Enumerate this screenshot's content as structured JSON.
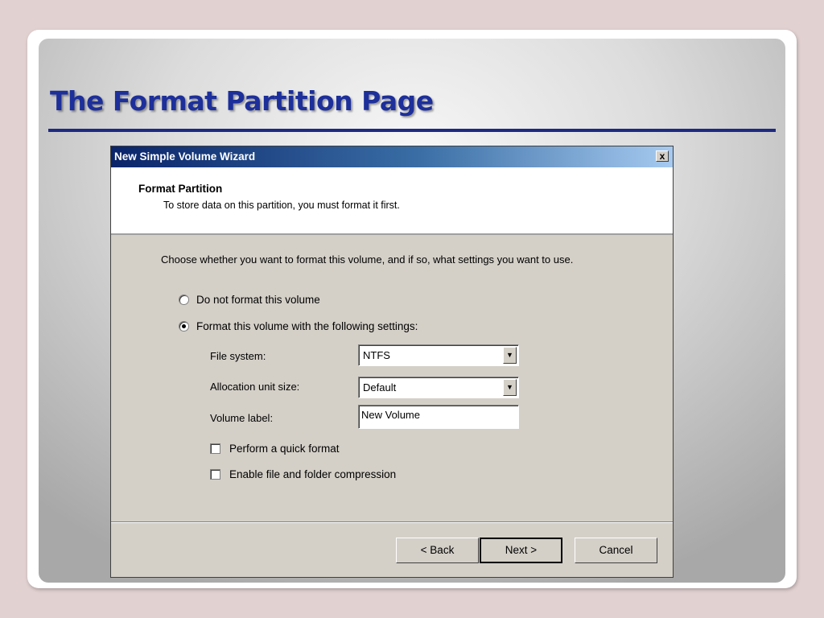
{
  "slide": {
    "title": "The Format Partition Page"
  },
  "wizard": {
    "window_title": "New Simple Volume Wizard",
    "close_label": "x",
    "header": {
      "title": "Format Partition",
      "subtitle": "To store data on this partition, you must format it first."
    },
    "instructions": "Choose whether you want to format this volume, and if so, what settings you want to use.",
    "options": {
      "no_format_label": "Do not format this volume",
      "no_format_selected": false,
      "format_label": "Format this volume with the following settings:",
      "format_selected": true
    },
    "fields": {
      "file_system_label": "File system:",
      "file_system_value": "NTFS",
      "allocation_label": "Allocation unit size:",
      "allocation_value": "Default",
      "volume_label_label": "Volume label:",
      "volume_label_value": "New Volume"
    },
    "checkboxes": {
      "quick_format_label": "Perform a quick format",
      "quick_format_checked": false,
      "compression_label": "Enable file and folder compression",
      "compression_checked": false
    },
    "buttons": {
      "back": "< Back",
      "next": "Next >",
      "cancel": "Cancel"
    }
  },
  "icons": {
    "dropdown": "chevron-down-icon",
    "close": "close-icon"
  },
  "colors": {
    "title_text": "#1d2f9a",
    "title_rule": "#1d2a82",
    "titlebar_start": "#0a246a",
    "titlebar_end": "#a6caf0",
    "dialog_bg": "#d4d0c8",
    "page_bg": "#e2d1d1"
  }
}
